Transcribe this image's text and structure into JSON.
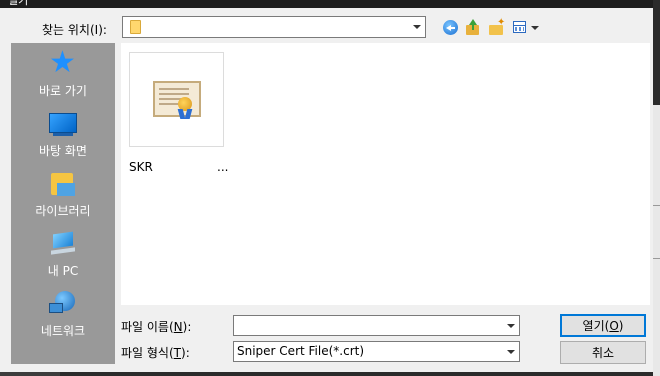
{
  "dialog": {
    "title": "열기"
  },
  "toolbar": {
    "look_in_label": "찾는 위치(I):",
    "look_in_value": "",
    "back_icon": "back-arrow-icon",
    "up_icon": "up-folder-icon",
    "new_folder_icon": "new-folder-icon",
    "views_icon": "view-menu-icon"
  },
  "places": [
    {
      "label": "바로 가기",
      "icon": "star-icon"
    },
    {
      "label": "바탕 화면",
      "icon": "desktop-icon"
    },
    {
      "label": "라이브러리",
      "icon": "library-icon"
    },
    {
      "label": "내 PC",
      "icon": "computer-icon"
    },
    {
      "label": "네트워크",
      "icon": "network-icon"
    }
  ],
  "files": [
    {
      "name": "SKR",
      "ellipsis": "...",
      "icon": "certificate-icon"
    }
  ],
  "filename": {
    "label": "파일 이름(N):",
    "label_pre": "파일 이름(",
    "label_key": "N",
    "label_post": "):",
    "value": ""
  },
  "filetype": {
    "label": "파일 형식(T):",
    "label_pre": "파일 형식(",
    "label_key": "T",
    "label_post": "):",
    "value": "Sniper Cert File(*.crt)"
  },
  "buttons": {
    "open_pre": "열기(",
    "open_key": "O",
    "open_post": ")",
    "cancel": "취소"
  },
  "colors": {
    "places_bg": "#999999",
    "default_button_border": "#0078d7",
    "dialog_bg": "#f0f0f0"
  }
}
